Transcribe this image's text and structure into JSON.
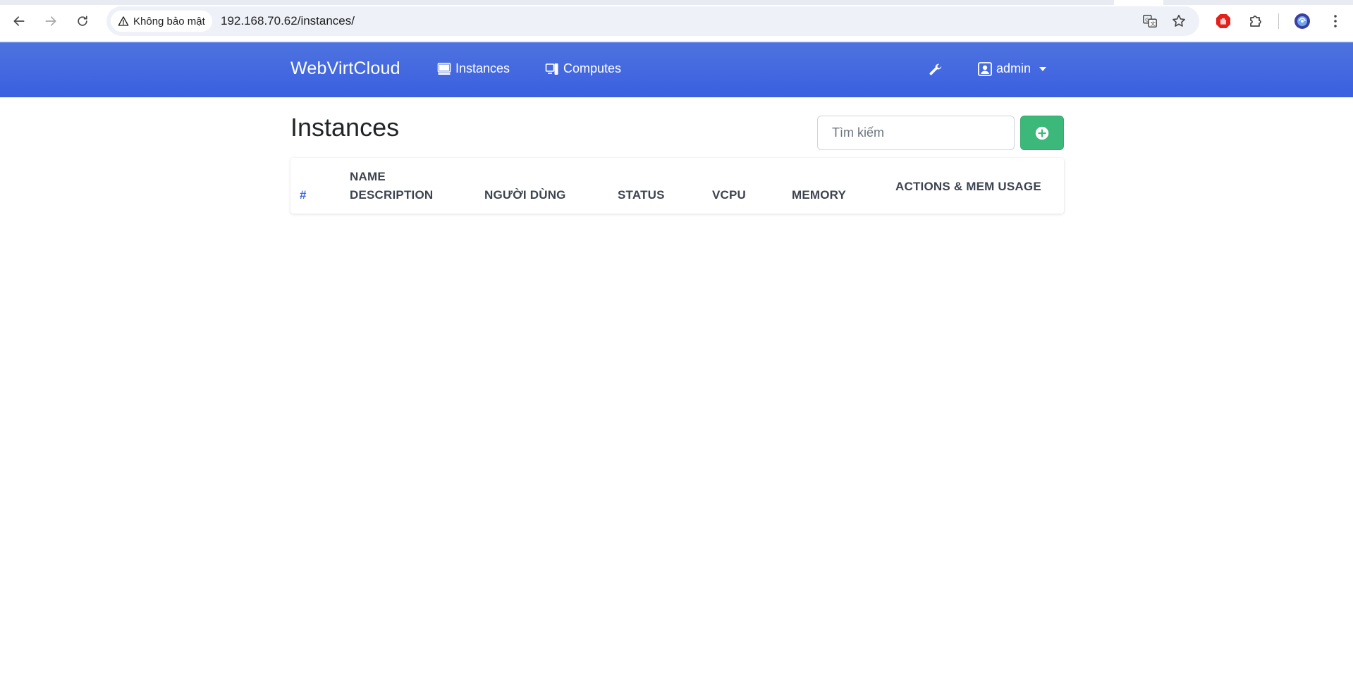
{
  "browser": {
    "security_label": "Không bảo mật",
    "url": "192.168.70.62/instances/",
    "icons": {
      "back": "arrow-left-icon",
      "forward": "arrow-right-icon",
      "reload": "reload-icon",
      "warning": "warning-triangle-icon",
      "translate": "translate-icon",
      "bookmark": "star-icon",
      "adblock": "stop-hand-icon",
      "extensions": "puzzle-piece-icon",
      "profile": "profile-avatar-icon",
      "menu": "kebab-menu-icon"
    }
  },
  "navbar": {
    "brand": "WebVirtCloud",
    "links": [
      {
        "label": "Instances",
        "icon": "monitor-icon"
      },
      {
        "label": "Computes",
        "icon": "server-icon"
      }
    ],
    "settings_icon": "wrench-icon",
    "user": {
      "label": "admin",
      "icon": "user-square-icon"
    },
    "colors": {
      "navbar": "#4e73df"
    }
  },
  "page": {
    "title": "Instances",
    "search": {
      "placeholder": "Tìm kiếm",
      "value": ""
    },
    "add_button": {
      "icon": "plus-circle-icon",
      "color": "#3cb87a"
    }
  },
  "table": {
    "columns": {
      "hash": "#",
      "name": "NAME",
      "description": "DESCRIPTION",
      "user": "NGƯỜI DÙNG",
      "status": "STATUS",
      "vcpu": "VCPU",
      "memory": "MEMORY",
      "actions": "ACTIONS & MEM USAGE"
    },
    "rows": []
  }
}
